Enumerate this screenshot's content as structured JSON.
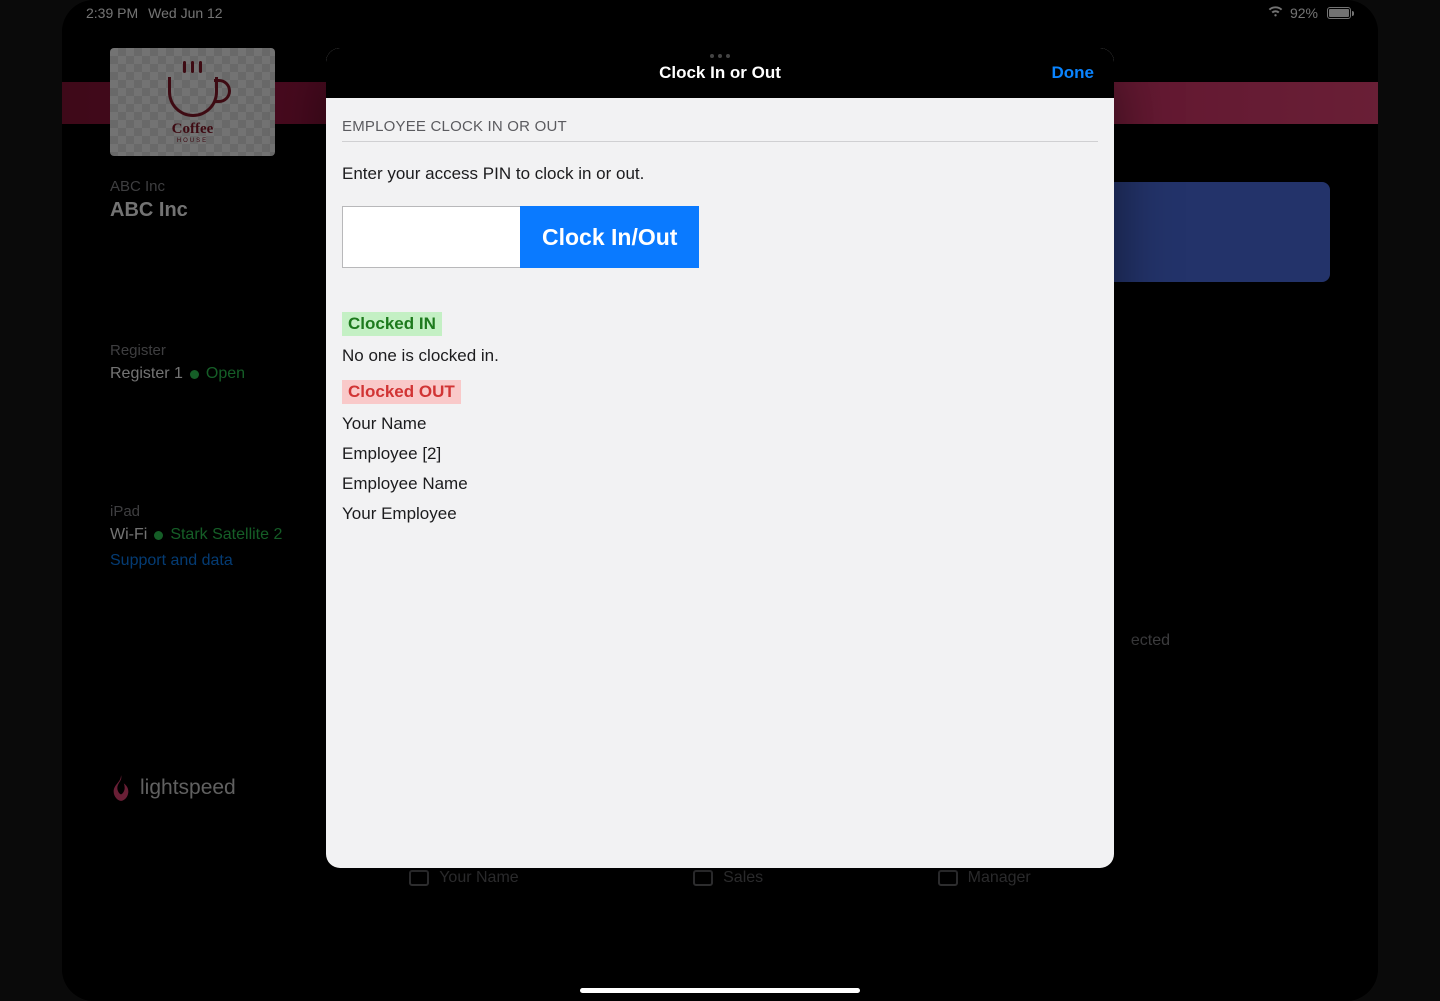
{
  "status_bar": {
    "time": "2:39 PM",
    "date": "Wed Jun 12",
    "battery_pct": "92%"
  },
  "sidebar": {
    "logo_text": "Coffee",
    "logo_sub": "HOUSE",
    "company_sub": "ABC Inc",
    "company_name": "ABC Inc",
    "register_label": "Register",
    "register_name": "Register 1",
    "register_status": "Open",
    "device_label": "iPad",
    "conn_label": "Wi-Fi",
    "wifi_name": "Stark Satellite 2",
    "support_link": "Support and data",
    "brand": "lightspeed"
  },
  "background_right_text": "ected",
  "bottom": {
    "user": "Your Name",
    "center": "Sales",
    "right": "Manager"
  },
  "modal": {
    "title": "Clock In or Out",
    "done": "Done",
    "section_header": "EMPLOYEE CLOCK IN OR OUT",
    "instruction": "Enter your access PIN to clock in or out.",
    "pin_value": "",
    "clock_btn": "Clock In/Out",
    "clocked_in_label": "Clocked IN",
    "clocked_in_empty": "No one is clocked in.",
    "clocked_out_label": "Clocked OUT",
    "clocked_out_list": [
      "Your Name",
      "Employee [2]",
      "Employee Name",
      "Your Employee"
    ]
  }
}
